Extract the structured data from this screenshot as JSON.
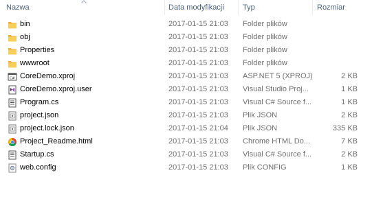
{
  "columns": {
    "name": "Nazwa",
    "date": "Data modyfikacji",
    "type": "Typ",
    "size": "Rozmiar"
  },
  "files": [
    {
      "name": "bin",
      "date": "2017-01-15 21:03",
      "type": "Folder plików",
      "size": "",
      "icon": "folder-icon"
    },
    {
      "name": "obj",
      "date": "2017-01-15 21:03",
      "type": "Folder plików",
      "size": "",
      "icon": "folder-icon"
    },
    {
      "name": "Properties",
      "date": "2017-01-15 21:03",
      "type": "Folder plików",
      "size": "",
      "icon": "folder-icon"
    },
    {
      "name": "wwwroot",
      "date": "2017-01-15 21:03",
      "type": "Folder plików",
      "size": "",
      "icon": "folder-icon"
    },
    {
      "name": "CoreDemo.xproj",
      "date": "2017-01-15 21:03",
      "type": "ASP.NET 5 (XPROJ)",
      "size": "2 KB",
      "icon": "xproj-icon"
    },
    {
      "name": "CoreDemo.xproj.user",
      "date": "2017-01-15 21:03",
      "type": "Visual Studio Proj...",
      "size": "1 KB",
      "icon": "vs-user-icon"
    },
    {
      "name": "Program.cs",
      "date": "2017-01-15 21:03",
      "type": "Visual C# Source f...",
      "size": "1 KB",
      "icon": "cs-file-icon"
    },
    {
      "name": "project.json",
      "date": "2017-01-15 21:03",
      "type": "Plik JSON",
      "size": "2 KB",
      "icon": "json-file-icon"
    },
    {
      "name": "project.lock.json",
      "date": "2017-01-15 21:04",
      "type": "Plik JSON",
      "size": "335 KB",
      "icon": "json-file-icon"
    },
    {
      "name": "Project_Readme.html",
      "date": "2017-01-15 21:03",
      "type": "Chrome HTML Do...",
      "size": "7 KB",
      "icon": "chrome-icon"
    },
    {
      "name": "Startup.cs",
      "date": "2017-01-15 21:03",
      "type": "Visual C# Source f...",
      "size": "2 KB",
      "icon": "cs-file-icon"
    },
    {
      "name": "web.config",
      "date": "2017-01-15 21:03",
      "type": "Plik CONFIG",
      "size": "1 KB",
      "icon": "config-file-icon"
    }
  ]
}
